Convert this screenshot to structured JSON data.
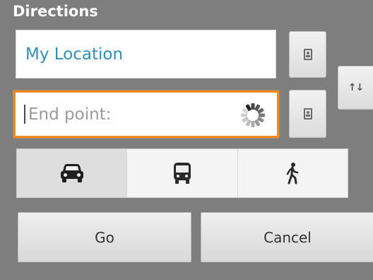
{
  "dialog": {
    "title": "Directions"
  },
  "start": {
    "value": "My Location"
  },
  "end": {
    "placeholder": "End point:"
  },
  "modes": [
    {
      "icon": "car-icon",
      "selected": true
    },
    {
      "icon": "bus-icon",
      "selected": false
    },
    {
      "icon": "walk-icon",
      "selected": false
    }
  ],
  "buttons": {
    "go": "Go",
    "cancel": "Cancel",
    "swap": "↑↓"
  },
  "colors": {
    "accent": "#f08c1e",
    "link": "#2f8fbd",
    "background": "#7e7e7e"
  }
}
